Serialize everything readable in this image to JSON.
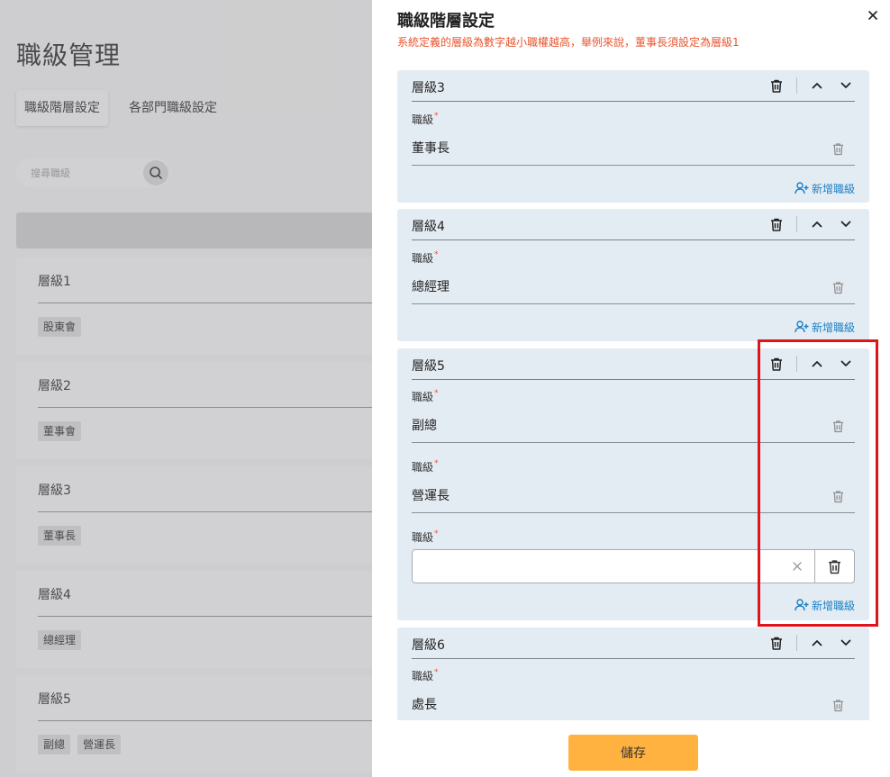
{
  "background": {
    "page_title": "職級管理",
    "tabs": [
      {
        "label": "職級階層設定",
        "active": true
      },
      {
        "label": "各部門職級設定",
        "active": false
      }
    ],
    "search_placeholder": "搜尋職級",
    "levels": [
      {
        "name": "層級1",
        "tags": [
          "股東會"
        ]
      },
      {
        "name": "層級2",
        "tags": [
          "董事會"
        ]
      },
      {
        "name": "層級3",
        "tags": [
          "董事長"
        ]
      },
      {
        "name": "層級4",
        "tags": [
          "總經理"
        ]
      },
      {
        "name": "層級5",
        "tags": [
          "副總",
          "營運長"
        ]
      }
    ]
  },
  "drawer": {
    "title": "職級階層設定",
    "subtitle": "系統定義的層級為數字越小職權越高，舉例來說，董事長須設定為層級1",
    "position_label": "職級",
    "add_position_label": "新增職級",
    "save_label": "儲存",
    "levels": [
      {
        "name": "層級3",
        "positions": [
          "董事長"
        ]
      },
      {
        "name": "層級4",
        "positions": [
          "總經理"
        ]
      },
      {
        "name": "層級5",
        "positions": [
          "副總",
          "營運長"
        ],
        "new_position_input": {
          "value": "",
          "placeholder": ""
        }
      },
      {
        "name": "層級6",
        "positions": [
          "處長"
        ]
      }
    ]
  },
  "colors": {
    "accent_button": "#ffb23f",
    "warning_text": "#e8552f",
    "link_blue": "#1b7fc4",
    "level_card_bg": "#e4ecf3",
    "highlight_box": "#e0141b"
  }
}
